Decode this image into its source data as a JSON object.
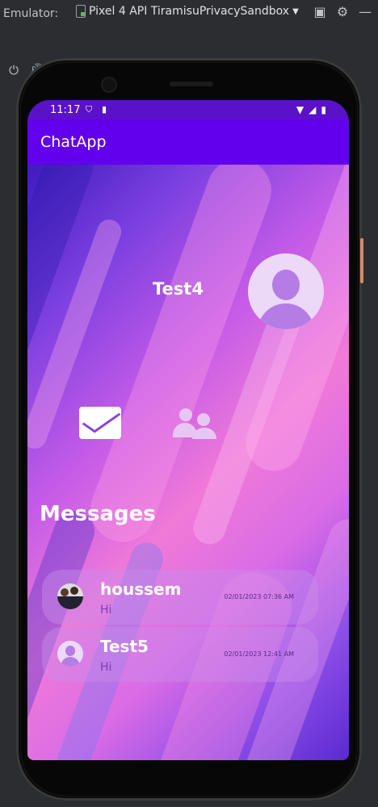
{
  "emulator": {
    "label": "Emulator:",
    "device_name": "Pixel 4 API TiramisuPrivacySandbox",
    "header_icons": [
      "window-mode-icon",
      "settings-icon",
      "minimize-icon"
    ],
    "toolbar_icons": [
      "power-icon",
      "volume-up-icon",
      "volume-down-icon",
      "rotate-left-icon",
      "rotate-right-icon",
      "back-icon",
      "home-icon",
      "overview-icon",
      "camera-icon",
      "snapshot-icon",
      "more-icon"
    ]
  },
  "status_bar": {
    "time": "11:17"
  },
  "app_bar": {
    "title": "ChatApp"
  },
  "profile": {
    "name": "Test4"
  },
  "section_heading": "Messages",
  "messages": [
    {
      "name": "houssem",
      "text": "Hi",
      "time": "02/01/2023  07:36 AM"
    },
    {
      "name": "Test5",
      "text": "Hi",
      "time": "02/01/2023  12:41 AM"
    }
  ],
  "colors": {
    "app_bar": "#6200ee",
    "status_bar": "#5a12c8",
    "accent": "#b57ce6"
  }
}
